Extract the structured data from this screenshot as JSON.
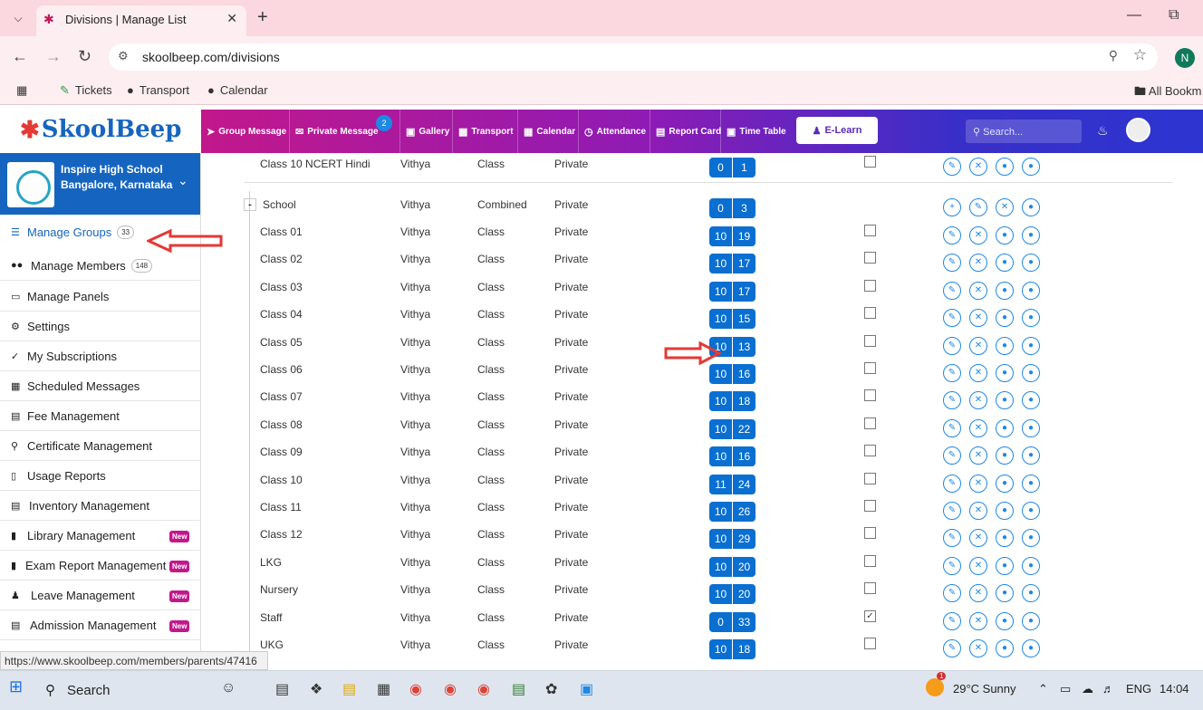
{
  "browser": {
    "tab_title": "Divisions | Manage List",
    "url": "skoolbeep.com/divisions",
    "profile_initial": "N",
    "bookmarks": [
      "Tickets",
      "Transport",
      "Calendar"
    ],
    "all_bookmarks": "All Bookm"
  },
  "header": {
    "logo_text": "SkoolBeep",
    "nav": [
      {
        "label": "Group Message",
        "icon": "send-icon"
      },
      {
        "label": "Private Message",
        "icon": "mail-icon"
      },
      {
        "label": "Gallery",
        "icon": "image-icon"
      },
      {
        "label": "Transport",
        "icon": "bus-icon"
      },
      {
        "label": "Calendar",
        "icon": "calendar-icon"
      },
      {
        "label": "Attendance",
        "icon": "clock-icon"
      },
      {
        "label": "Report Card",
        "icon": "document-icon"
      },
      {
        "label": "Time Table",
        "icon": "timetable-icon"
      }
    ],
    "private_message_badge": "2",
    "elearn_label": "E-Learn",
    "search_placeholder": "Search..."
  },
  "sidebar": {
    "school_name": "Inspire High School",
    "school_location": "Bangalore, Karnataka",
    "items": [
      {
        "label": "Manage Groups",
        "count": "33",
        "icon": "list-icon",
        "active": true
      },
      {
        "label": "Manage Members",
        "count": "148",
        "icon": "users-icon"
      },
      {
        "label": "Manage Panels",
        "icon": "monitor-icon"
      },
      {
        "label": "Settings",
        "icon": "gear-icon"
      },
      {
        "label": "My Subscriptions",
        "icon": "check-icon"
      },
      {
        "label": "Scheduled Messages",
        "icon": "calendar-icon"
      },
      {
        "label": "Fee Management",
        "icon": "receipt-icon"
      },
      {
        "label": "Certificate Management",
        "icon": "certificate-icon"
      },
      {
        "label": "Usage Reports",
        "icon": "bar-chart-icon"
      },
      {
        "label": "Inventory Management",
        "icon": "inventory-icon"
      },
      {
        "label": "Library Management",
        "icon": "book-icon",
        "new": "New"
      },
      {
        "label": "Exam Report Management",
        "icon": "exam-icon",
        "new": "New"
      },
      {
        "label": "Leave Management",
        "icon": "leave-icon",
        "new": "New"
      },
      {
        "label": "Admission Management",
        "icon": "admission-icon",
        "new": "New"
      }
    ]
  },
  "status_url": "https://www.skoolbeep.com/members/parents/47416",
  "table": {
    "top_row": {
      "name": "Class 10 NCERT Hindi",
      "owner": "Vithya",
      "type": "Class",
      "privacy": "Private",
      "a": "0",
      "b": "1",
      "checked": false
    },
    "group": {
      "name": "School",
      "owner": "Vithya",
      "type": "Combined",
      "privacy": "Private",
      "a": "0",
      "b": "3",
      "toggle": "-"
    },
    "rows": [
      {
        "name": "Class 01",
        "owner": "Vithya",
        "type": "Class",
        "privacy": "Private",
        "a": "10",
        "b": "19",
        "checked": false
      },
      {
        "name": "Class 02",
        "owner": "Vithya",
        "type": "Class",
        "privacy": "Private",
        "a": "10",
        "b": "17",
        "checked": false
      },
      {
        "name": "Class 03",
        "owner": "Vithya",
        "type": "Class",
        "privacy": "Private",
        "a": "10",
        "b": "17",
        "checked": false
      },
      {
        "name": "Class 04",
        "owner": "Vithya",
        "type": "Class",
        "privacy": "Private",
        "a": "10",
        "b": "15",
        "checked": false
      },
      {
        "name": "Class 05",
        "owner": "Vithya",
        "type": "Class",
        "privacy": "Private",
        "a": "10",
        "b": "13",
        "checked": false
      },
      {
        "name": "Class 06",
        "owner": "Vithya",
        "type": "Class",
        "privacy": "Private",
        "a": "10",
        "b": "16",
        "checked": false
      },
      {
        "name": "Class 07",
        "owner": "Vithya",
        "type": "Class",
        "privacy": "Private",
        "a": "10",
        "b": "18",
        "checked": false
      },
      {
        "name": "Class 08",
        "owner": "Vithya",
        "type": "Class",
        "privacy": "Private",
        "a": "10",
        "b": "22",
        "checked": false
      },
      {
        "name": "Class 09",
        "owner": "Vithya",
        "type": "Class",
        "privacy": "Private",
        "a": "10",
        "b": "16",
        "checked": false
      },
      {
        "name": "Class 10",
        "owner": "Vithya",
        "type": "Class",
        "privacy": "Private",
        "a": "11",
        "b": "24",
        "checked": false
      },
      {
        "name": "Class 11",
        "owner": "Vithya",
        "type": "Class",
        "privacy": "Private",
        "a": "10",
        "b": "26",
        "checked": false
      },
      {
        "name": "Class 12",
        "owner": "Vithya",
        "type": "Class",
        "privacy": "Private",
        "a": "10",
        "b": "29",
        "checked": false
      },
      {
        "name": "LKG",
        "owner": "Vithya",
        "type": "Class",
        "privacy": "Private",
        "a": "10",
        "b": "20",
        "checked": false
      },
      {
        "name": "Nursery",
        "owner": "Vithya",
        "type": "Class",
        "privacy": "Private",
        "a": "10",
        "b": "20",
        "checked": false
      },
      {
        "name": "Staff",
        "owner": "Vithya",
        "type": "Class",
        "privacy": "Private",
        "a": "0",
        "b": "33",
        "checked": true
      },
      {
        "name": "UKG",
        "owner": "Vithya",
        "type": "Class",
        "privacy": "Private",
        "a": "10",
        "b": "18",
        "checked": false
      }
    ]
  },
  "taskbar": {
    "search_label": "Search",
    "weather_badge": "1",
    "weather": "29°C  Sunny",
    "language": "ENG",
    "time": "14:04"
  },
  "colors": {
    "brand_blue": "#1565c0",
    "pill_blue": "#0a6fd1",
    "new_badge": "#c2188b",
    "annotation_red": "#e53935"
  }
}
